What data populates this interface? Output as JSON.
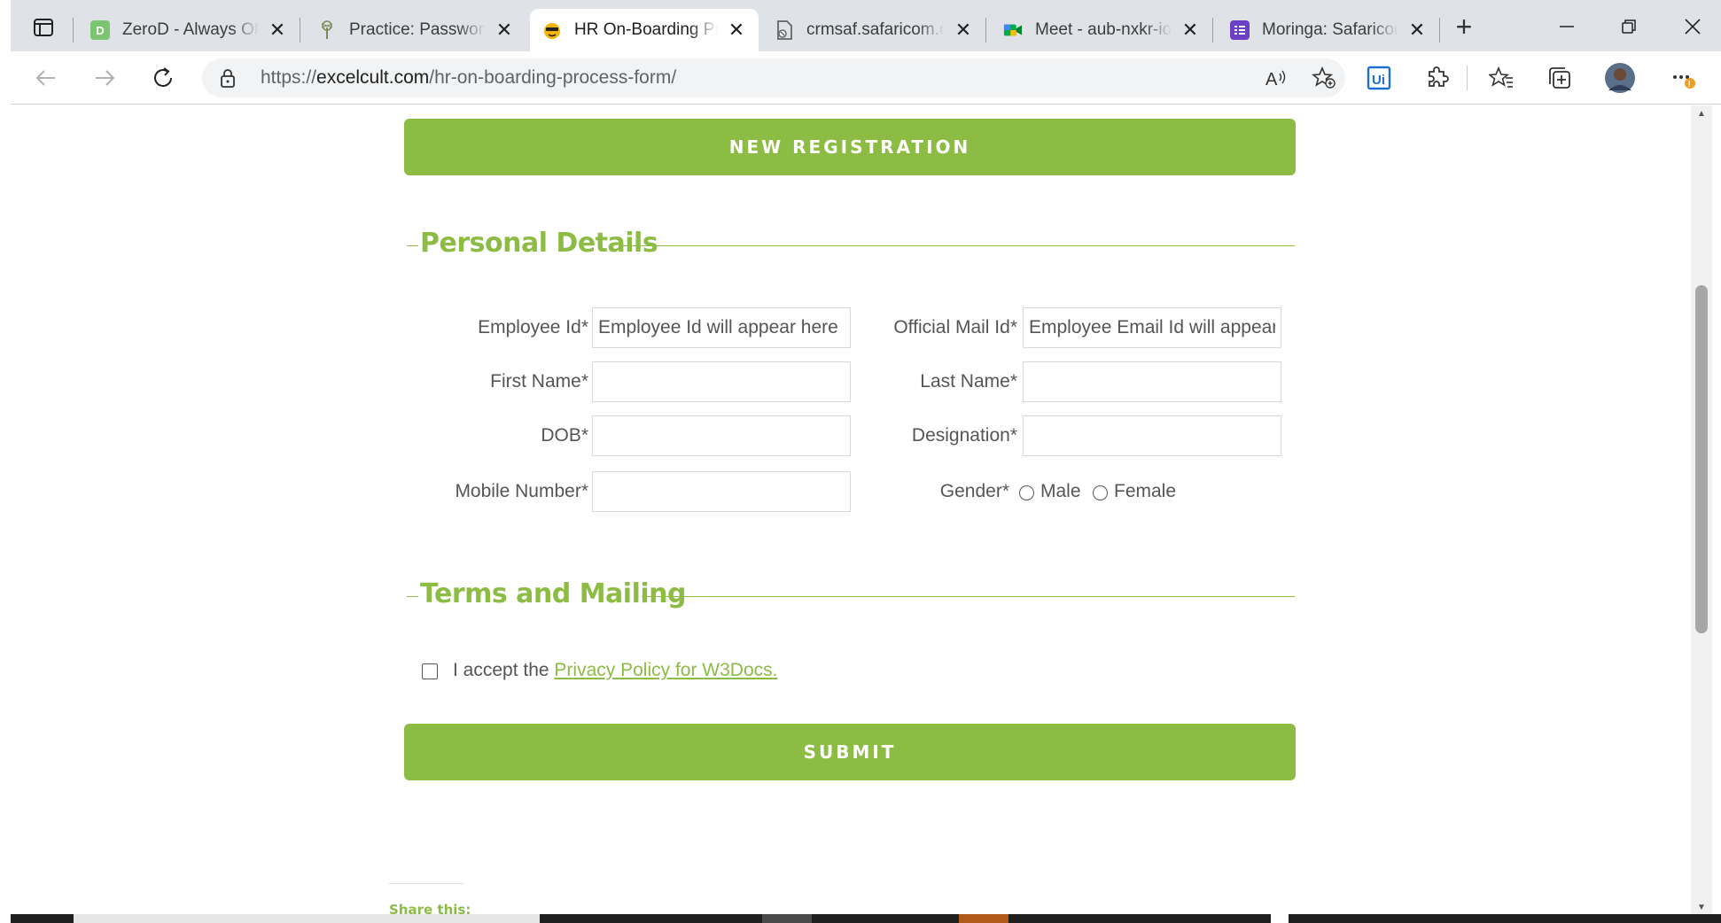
{
  "browser": {
    "tabs": [
      {
        "title": "ZeroD - Always ON",
        "icon": "zerod-icon",
        "active": false
      },
      {
        "title": "Practice: Password Cracking",
        "icon": "tree-icon",
        "active": false
      },
      {
        "title": "HR On-Boarding Process Form",
        "icon": "excelcult-icon",
        "active": true
      },
      {
        "title": "crmsaf.safaricom.co.ke",
        "icon": "document-icon",
        "active": false
      },
      {
        "title": "Meet - aub-nxkr-iow",
        "icon": "meet-icon",
        "active": false
      },
      {
        "title": "Moringa: Safaricom",
        "icon": "forms-icon",
        "active": false
      }
    ],
    "url_prefix": "https://",
    "url_host": "excelcult.com",
    "url_path": "/hr-on-boarding-process-form/"
  },
  "page": {
    "new_registration": "NEW REGISTRATION",
    "personal_details": "Personal Details",
    "fields": {
      "employee_id_label": "Employee Id*",
      "employee_id_placeholder": "Employee Id will appear here",
      "official_mail_label": "Official Mail Id*",
      "official_mail_placeholder": "Employee Email Id will appear",
      "first_name_label": "First Name*",
      "last_name_label": "Last Name*",
      "dob_label": "DOB*",
      "designation_label": "Designation*",
      "mobile_label": "Mobile Number*",
      "gender_label": "Gender*",
      "gender_male": "Male",
      "gender_female": "Female"
    },
    "terms_heading": "Terms and Mailing",
    "terms_text": "I accept the",
    "terms_link": "Privacy Policy for W3Docs.",
    "submit": "SUBMIT",
    "share": "Share this:"
  },
  "colors": {
    "accent": "#8cbc44"
  }
}
